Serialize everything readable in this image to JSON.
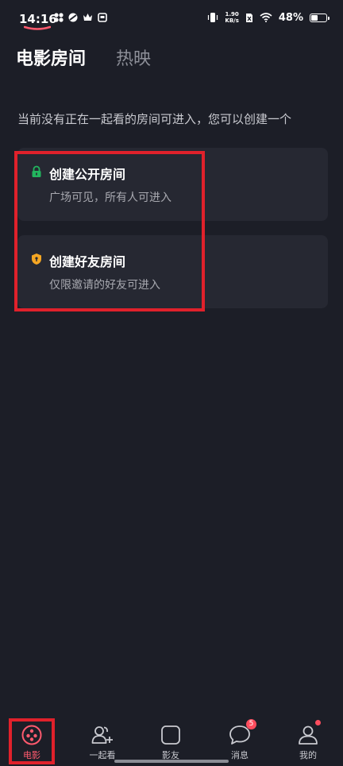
{
  "status_bar": {
    "time": "14:16",
    "net_speed_value": "1.90",
    "net_speed_unit": "KB/s",
    "battery_percent": "48%",
    "battery_level": 0.48
  },
  "tabs": [
    {
      "label": "电影房间",
      "active": true
    },
    {
      "label": "热映",
      "active": false
    }
  ],
  "hint": "当前没有正在一起看的房间可进入，您可以创建一个",
  "cards": [
    {
      "title": "创建公开房间",
      "subtitle": "广场可见，所有人可进入",
      "icon": "lock-icon",
      "icon_color": "#22b55e"
    },
    {
      "title": "创建好友房间",
      "subtitle": "仅限邀请的好友可进入",
      "icon": "shield-icon",
      "icon_color": "#f4a623"
    }
  ],
  "bottom_nav": [
    {
      "label": "电影",
      "icon": "film-reel-icon",
      "active": true
    },
    {
      "label": "一起看",
      "icon": "add-friend-icon",
      "active": false
    },
    {
      "label": "影友",
      "icon": "square-icon",
      "active": false
    },
    {
      "label": "消息",
      "icon": "chat-bubble-icon",
      "active": false,
      "badge": "5"
    },
    {
      "label": "我的",
      "icon": "profile-icon",
      "active": false,
      "dot": true
    }
  ],
  "colors": {
    "accent": "#ff5a6e",
    "highlight": "#e0212b",
    "background": "#1c1e27",
    "card": "#262832"
  }
}
